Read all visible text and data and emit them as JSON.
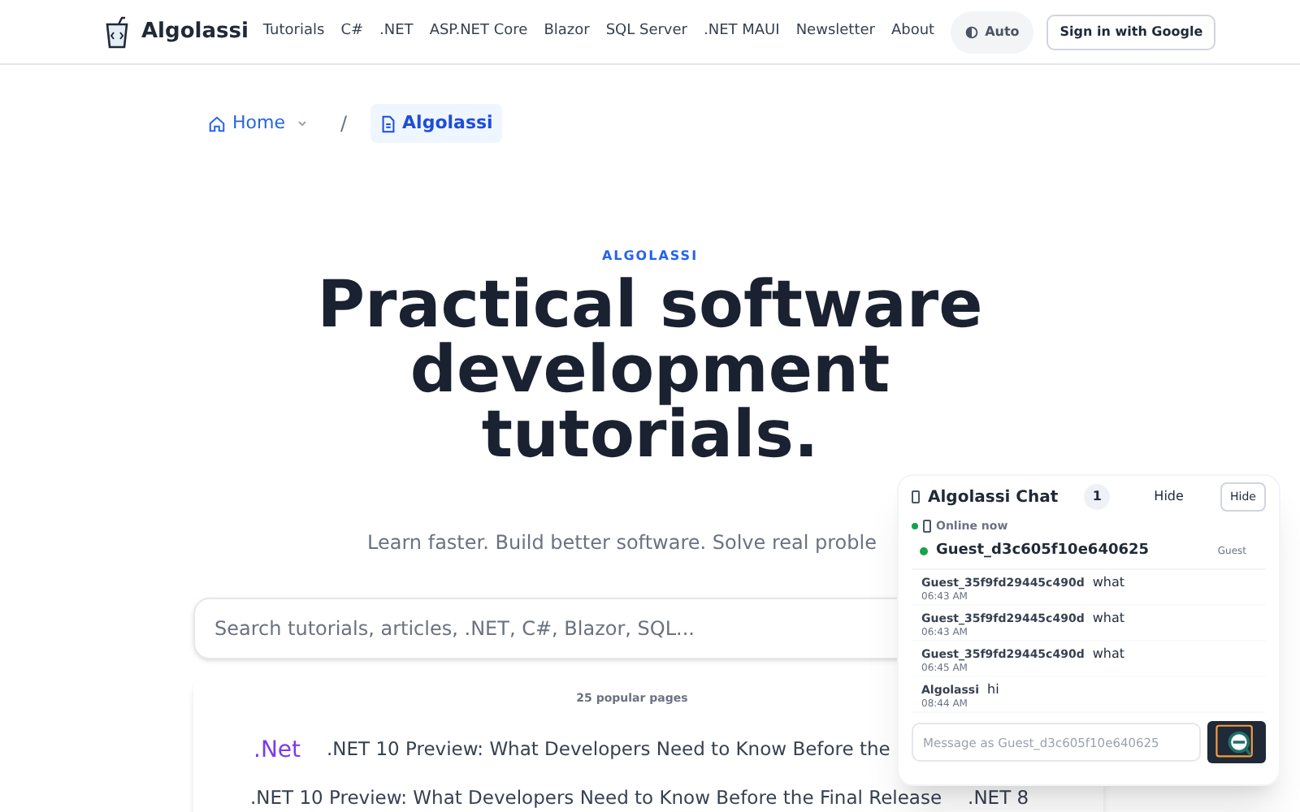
{
  "header": {
    "logo": "Algolassi",
    "nav": [
      "Tutorials",
      "C#",
      ".NET",
      "ASP.NET Core",
      "Blazor",
      "SQL Server",
      ".NET MAUI",
      "Newsletter",
      "About"
    ],
    "theme_toggle": "Auto",
    "sign_in": "Sign in with Google"
  },
  "breadcrumb": {
    "separator": "/",
    "items": [
      {
        "label": "Home",
        "selected": false
      },
      {
        "label": "Algolassi",
        "selected": true
      }
    ]
  },
  "hero": {
    "eyebrow": "ALGOLASSI",
    "title": "Practical software development tutorials.",
    "subtitle": "Learn faster. Build better software. Solve real proble"
  },
  "search": {
    "placeholder": "Search tutorials, articles, .NET, C#, Blazor, SQL..."
  },
  "popular": {
    "count_label": "25 popular pages",
    "featured": {
      "tag": ".Net",
      "title": ".NET 10 Preview: What Developers Need to Know Before the"
    },
    "next_line": [
      ".NET 10 Preview: What Developers Need to Know Before the Final Release",
      ".NET 8"
    ]
  },
  "chat": {
    "title": "Algolassi Chat",
    "badge": "1",
    "hide_link": "Hide",
    "hide_button": "Hide",
    "status": "Online now",
    "online": true,
    "user": {
      "name": "Guest_d3c605f10e640625",
      "role": "Guest",
      "online": true
    },
    "messages": [
      {
        "author": "Guest_35f9fd29445c490d",
        "text": "what",
        "time": "06:43 AM"
      },
      {
        "author": "Guest_35f9fd29445c490d",
        "text": "what",
        "time": "06:43 AM"
      },
      {
        "author": "Guest_35f9fd29445c490d",
        "text": "what",
        "time": "06:45 AM"
      },
      {
        "author": "Algolassi",
        "text": "hi",
        "time": "08:44 AM"
      }
    ],
    "input": {
      "placeholder": "Message as Guest_d3c605f10e640625"
    }
  }
}
